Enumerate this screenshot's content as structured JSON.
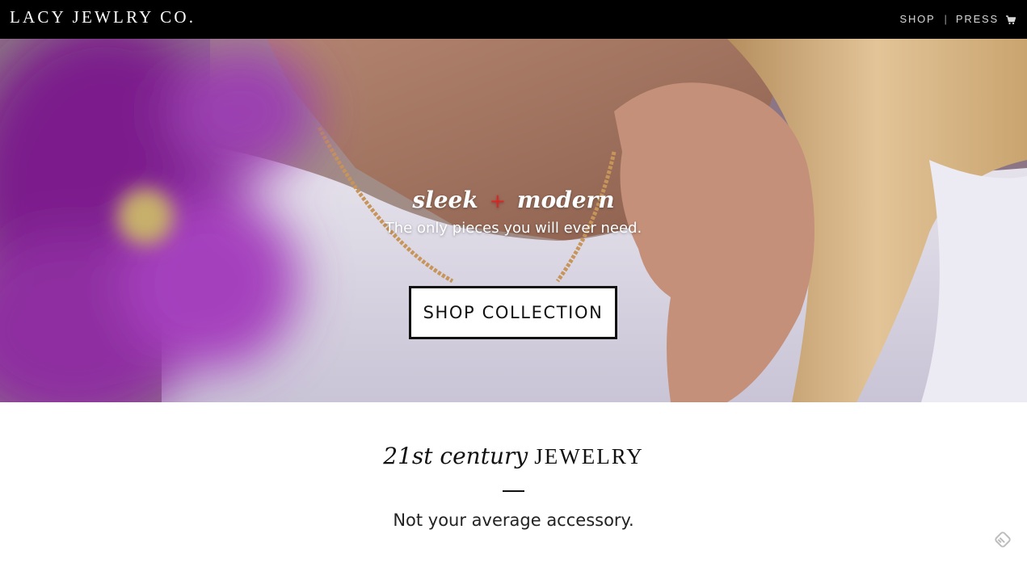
{
  "header": {
    "logo": "LACY JEWLRY CO.",
    "nav": [
      {
        "label": "SHOP"
      },
      {
        "label": "PRESS"
      }
    ],
    "separator": "|",
    "cart_icon": "cart-icon"
  },
  "hero": {
    "title_left": "sleek",
    "title_plus": "+",
    "title_right": "modern",
    "subtitle": "The only pieces you will ever need.",
    "cta_label": "SHOP COLLECTION"
  },
  "section": {
    "heading_italic": "21st century",
    "heading_caps": "JEWELRY",
    "tagline": "Not your average accessory."
  },
  "corner_icon": "feedly-icon",
  "colors": {
    "topbar": "#000000",
    "accent_plus": "#e62020",
    "button_border": "#111111"
  }
}
